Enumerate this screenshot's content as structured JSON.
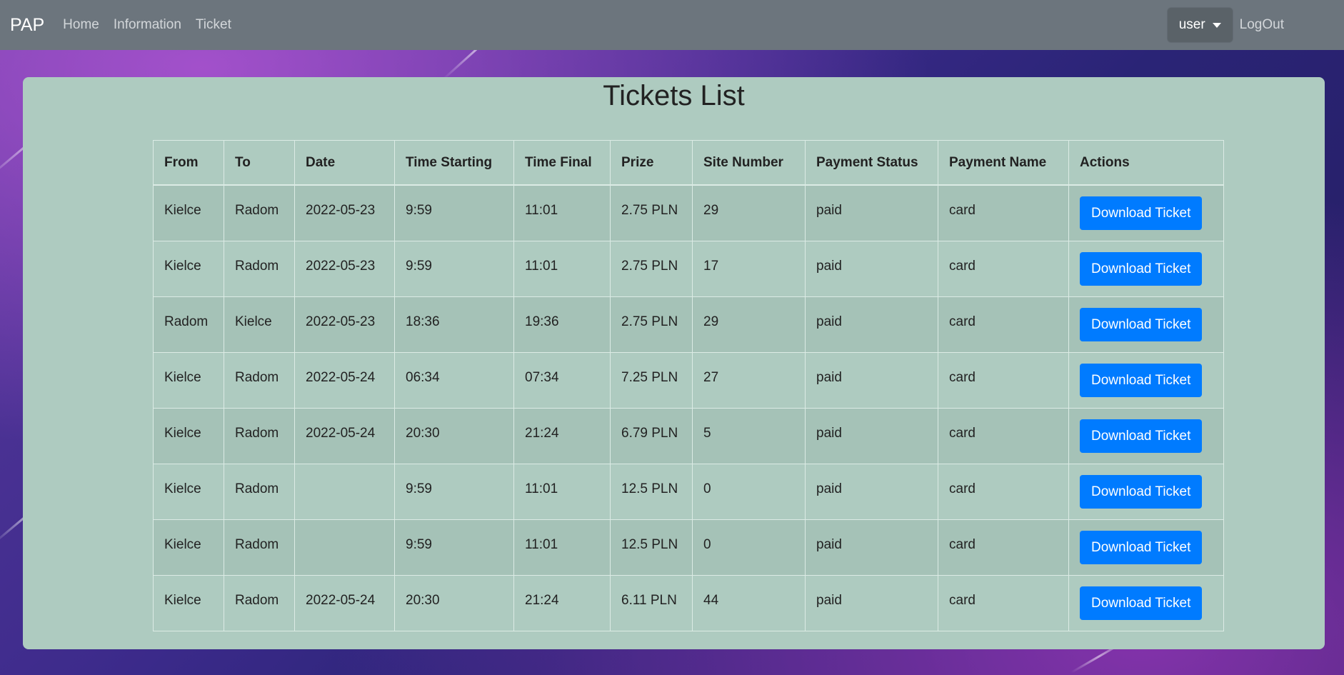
{
  "navbar": {
    "brand": "PAP",
    "links": [
      "Home",
      "Information",
      "Ticket"
    ],
    "user_label": "user",
    "logout_label": "LogOut"
  },
  "page": {
    "title": "Tickets List"
  },
  "table": {
    "headers": [
      "From",
      "To",
      "Date",
      "Time Starting",
      "Time Final",
      "Prize",
      "Site Number",
      "Payment Status",
      "Payment Name",
      "Actions"
    ],
    "action_label": "Download Ticket",
    "rows": [
      {
        "from": "Kielce",
        "to": "Radom",
        "date": "2022-05-23",
        "time_start": "9:59",
        "time_final": "11:01",
        "prize": "2.75 PLN",
        "site": "29",
        "status": "paid",
        "payment": "card"
      },
      {
        "from": "Kielce",
        "to": "Radom",
        "date": "2022-05-23",
        "time_start": "9:59",
        "time_final": "11:01",
        "prize": "2.75 PLN",
        "site": "17",
        "status": "paid",
        "payment": "card"
      },
      {
        "from": "Radom",
        "to": "Kielce",
        "date": "2022-05-23",
        "time_start": "18:36",
        "time_final": "19:36",
        "prize": "2.75 PLN",
        "site": "29",
        "status": "paid",
        "payment": "card"
      },
      {
        "from": "Kielce",
        "to": "Radom",
        "date": "2022-05-24",
        "time_start": "06:34",
        "time_final": "07:34",
        "prize": "7.25 PLN",
        "site": "27",
        "status": "paid",
        "payment": "card"
      },
      {
        "from": "Kielce",
        "to": "Radom",
        "date": "2022-05-24",
        "time_start": "20:30",
        "time_final": "21:24",
        "prize": "6.79 PLN",
        "site": "5",
        "status": "paid",
        "payment": "card"
      },
      {
        "from": "Kielce",
        "to": "Radom",
        "date": "",
        "time_start": "9:59",
        "time_final": "11:01",
        "prize": "12.5 PLN",
        "site": "0",
        "status": "paid",
        "payment": "card"
      },
      {
        "from": "Kielce",
        "to": "Radom",
        "date": "",
        "time_start": "9:59",
        "time_final": "11:01",
        "prize": "12.5 PLN",
        "site": "0",
        "status": "paid",
        "payment": "card"
      },
      {
        "from": "Kielce",
        "to": "Radom",
        "date": "2022-05-24",
        "time_start": "20:30",
        "time_final": "21:24",
        "prize": "6.11 PLN",
        "site": "44",
        "status": "paid",
        "payment": "card"
      }
    ]
  },
  "colors": {
    "navbar": "#6c757d",
    "panel": "#aecbc0",
    "button": "#007bff"
  }
}
